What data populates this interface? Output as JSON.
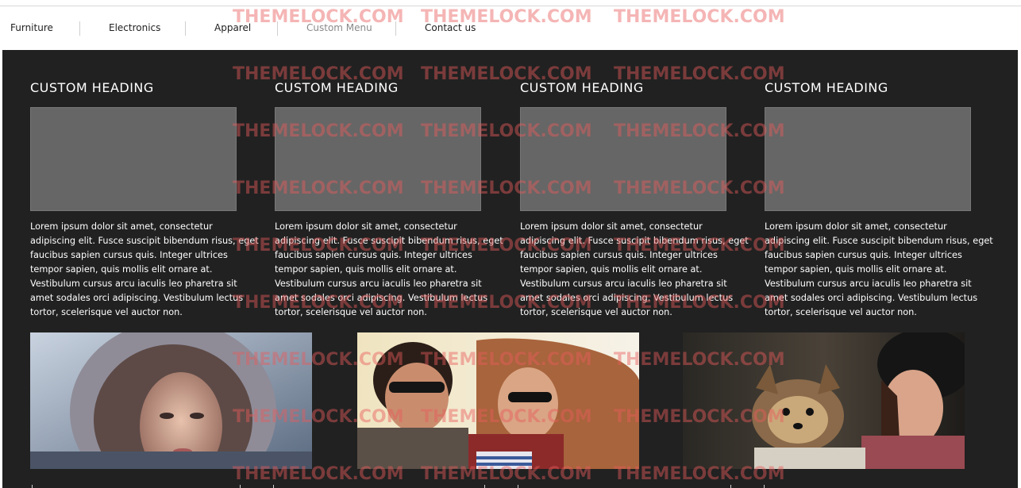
{
  "nav": {
    "items": [
      {
        "label": "Furniture"
      },
      {
        "label": "Electronics"
      },
      {
        "label": "Apparel"
      },
      {
        "label": "Custom Menu"
      },
      {
        "label": "Contact us"
      }
    ]
  },
  "columns": [
    {
      "heading": "CUSTOM HEADING",
      "text": "Lorem ipsum dolor sit amet, consectetur adipiscing elit. Fusce suscipit bibendum risus, eget faucibus sapien cursus quis. Integer ultrices tempor sapien, quis mollis elit ornare at. Vestibulum cursus arcu iaculis leo pharetra sit amet sodales orci adipiscing. Vestibulum lectus tortor, scelerisque vel auctor non."
    },
    {
      "heading": "CUSTOM HEADING",
      "text": "Lorem ipsum dolor sit amet, consectetur adipiscing elit. Fusce suscipit bibendum risus, eget faucibus sapien cursus quis. Integer ultrices tempor sapien, quis mollis elit ornare at. Vestibulum cursus arcu iaculis leo pharetra sit amet sodales orci adipiscing. Vestibulum lectus tortor, scelerisque vel auctor non."
    },
    {
      "heading": "CUSTOM HEADING",
      "text": "Lorem ipsum dolor sit amet, consectetur adipiscing elit. Fusce suscipit bibendum risus, eget faucibus sapien cursus quis. Integer ultrices tempor sapien, quis mollis elit ornare at. Vestibulum cursus arcu iaculis leo pharetra sit amet sodales orci adipiscing. Vestibulum lectus tortor, scelerisque vel auctor non."
    },
    {
      "heading": "CUSTOM HEADING",
      "text": "Lorem ipsum dolor sit amet, consectetur adipiscing elit. Fusce suscipit bibendum risus, eget faucibus sapien cursus quis. Integer ultrices tempor sapien, quis mollis elit ornare at. Vestibulum cursus arcu iaculis leo pharetra sit amet sodales orci adipiscing. Vestibulum lectus tortor, scelerisque vel auctor non."
    }
  ],
  "watermark": "THEMELOCK.COM",
  "colors": {
    "panel_bg": "#212121",
    "placeholder": "#666666",
    "watermark": "#e85a5a"
  }
}
